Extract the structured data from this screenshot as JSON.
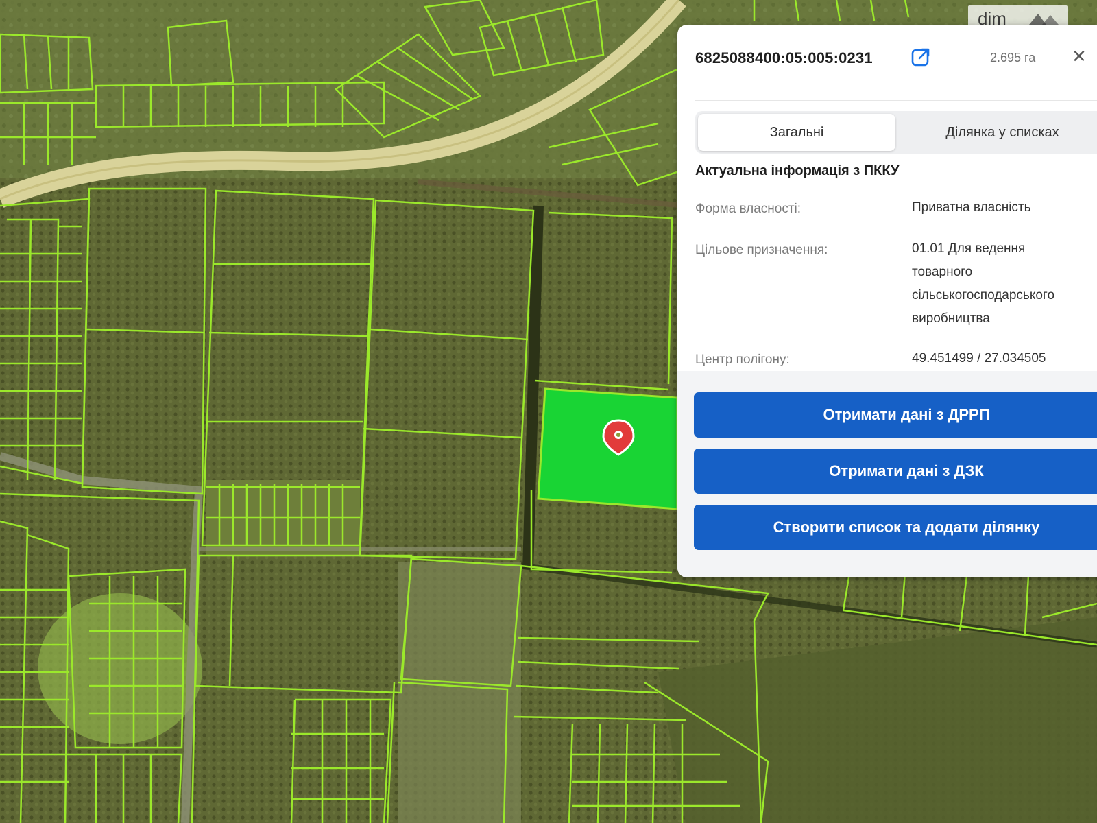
{
  "map": {
    "watermark_text": "dim",
    "parcel_outline_color": "#9be82b",
    "selected_parcel_color": "#19d434",
    "road_color": "#d9d39a",
    "marker_icon": "map-pin-icon"
  },
  "panel": {
    "cadastral_number": "6825088400:05:005:0231",
    "area": "2.695 га",
    "tabs": [
      {
        "label": "Загальні",
        "active": true
      },
      {
        "label": "Ділянка у списках",
        "active": false
      }
    ],
    "section_title": "Актуальна інформація з ПККУ",
    "rows": [
      {
        "label": "Форма власності:",
        "value": "Приватна власність"
      },
      {
        "label": "Цільове призначення:",
        "value_lines": [
          "01.01 Для ведення",
          "товарного",
          "сільськогосподарського",
          "виробництва"
        ]
      },
      {
        "label": "Центр полігону:",
        "value": "49.451499 / 27.034505"
      }
    ],
    "buttons": [
      {
        "label": "Отримати дані з ДРРП"
      },
      {
        "label": "Отримати дані з ДЗК"
      },
      {
        "label": "Створити список та додати ділянку"
      }
    ]
  }
}
